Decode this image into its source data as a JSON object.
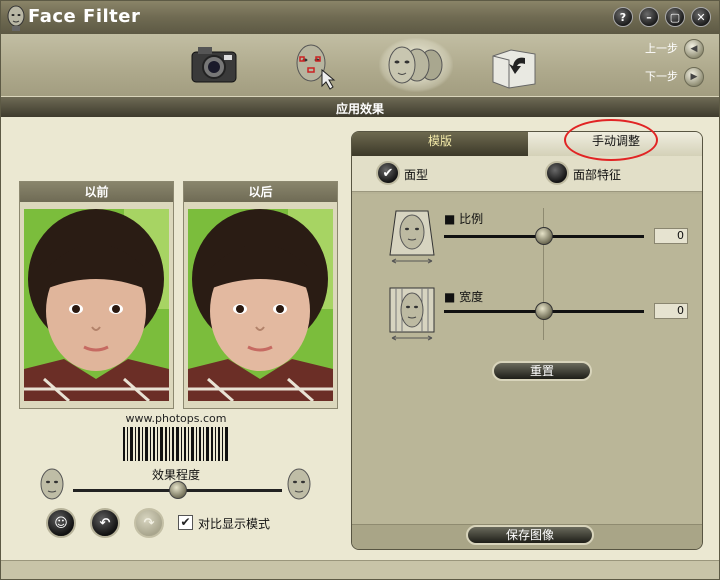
{
  "app": {
    "title": "Face Filter",
    "window_buttons": {
      "help": "?",
      "minimize": "–",
      "restore": "▢",
      "close": "✕"
    }
  },
  "toolbar": {
    "tools": [
      {
        "icon": "camera-icon"
      },
      {
        "icon": "face-select-icon"
      },
      {
        "icon": "face-filter-icon"
      },
      {
        "icon": "export-icon"
      }
    ],
    "prev_step": "上一步",
    "next_step": "下一步"
  },
  "section": {
    "title": "应用效果"
  },
  "before_panel": {
    "label": "以前"
  },
  "after_panel": {
    "label": "以后"
  },
  "watermark": "www.photops.com",
  "effect": {
    "label": "效果程度",
    "level": 0.5
  },
  "bottom_controls": {
    "compare_label": "对比显示模式",
    "compare_checked": true
  },
  "adjust_panel": {
    "tabs": [
      {
        "label": "模版",
        "active": false
      },
      {
        "label": "手动调整",
        "active": true
      }
    ],
    "options": [
      {
        "label": "面型",
        "checked": true
      },
      {
        "label": "面部特征",
        "checked": false
      }
    ],
    "sliders": [
      {
        "label": "比例",
        "value": "0"
      },
      {
        "label": "宽度",
        "value": "0"
      }
    ],
    "reset_label": "重置",
    "save_label": "保存图像"
  },
  "colors": {
    "accent_dark": "#3c3929",
    "panel_bg": "#b6b295",
    "highlight": "#e12424"
  }
}
